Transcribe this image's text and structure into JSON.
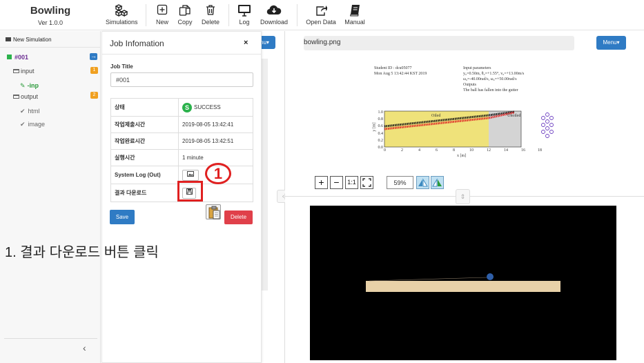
{
  "app": {
    "title": "Bowling",
    "version": "Ver 1.0.0"
  },
  "toolbar": [
    {
      "label": "Simulations",
      "icon": "cubes-icon"
    },
    {
      "label": "New",
      "icon": "plus-box-icon"
    },
    {
      "label": "Copy",
      "icon": "copy-icon"
    },
    {
      "label": "Delete",
      "icon": "trash-icon"
    },
    {
      "label": "Log",
      "icon": "monitor-icon"
    },
    {
      "label": "Download",
      "icon": "cloud-download-icon"
    },
    {
      "label": "Open Data",
      "icon": "share-icon"
    },
    {
      "label": "Manual",
      "icon": "book-icon"
    }
  ],
  "tree": {
    "header": "New Simulation",
    "job": "#001",
    "input_label": "input",
    "input_badge": "1",
    "input_file": "-inp",
    "output_label": "output",
    "output_badge": "2",
    "outputs": [
      "html",
      "image"
    ]
  },
  "job_info": {
    "title": "Job Infomation",
    "close": "×",
    "job_title_label": "Job Title",
    "job_title_value": "#001",
    "rows": [
      {
        "key": "상태",
        "value": "SUCCESS"
      },
      {
        "key": "작업제출시간",
        "value": "2019-08-05 13:42:41"
      },
      {
        "key": "작업완료시간",
        "value": "2019-08-05 13:42:51"
      },
      {
        "key": "실행시간",
        "value": "1 minute"
      },
      {
        "key": "System Log (Out)",
        "value": ""
      },
      {
        "key": "결과 다운로드",
        "value": ""
      }
    ],
    "save": "Save",
    "delete": "Delete",
    "annotation_number": "1"
  },
  "caption": "1. 결과 다운로드 버튼 클릭",
  "viewer": {
    "filename": "bowling.png",
    "menu": "Menu▾",
    "menu_partial": "nu▾",
    "zoom": "59%",
    "zoom_one": "1:1"
  },
  "plot": {
    "student": "Student ID : dcu05077",
    "date": "Mon Aug  5 13:42:44 KST 2019",
    "params_title": "Input parameters",
    "params": [
      "y₀=0.50m, θ₀=+1.55°, v₀=+13.00m/s",
      "ω₀=-40.00rad/s, ω₀=+50.00rad/s"
    ],
    "outputs_title": "Outputs",
    "outputs_text": "The ball has fallen into the gutter",
    "label_oiled": "Oiled",
    "label_unoiled": "Unoiled",
    "xlabel": "x [m]",
    "ylabel": "y [m]",
    "xticks": [
      "0",
      "2",
      "4",
      "6",
      "8",
      "10",
      "12",
      "14",
      "16",
      "18"
    ],
    "yticks": [
      "0.0",
      "0.2",
      "0.4",
      "0.6",
      "0.8",
      "1.0"
    ]
  },
  "colors": {
    "primary": "#2f7bc4",
    "danger": "#e0404a",
    "success": "#2bb24c",
    "highlight": "#e02020",
    "lane": "#e8d1a8"
  }
}
